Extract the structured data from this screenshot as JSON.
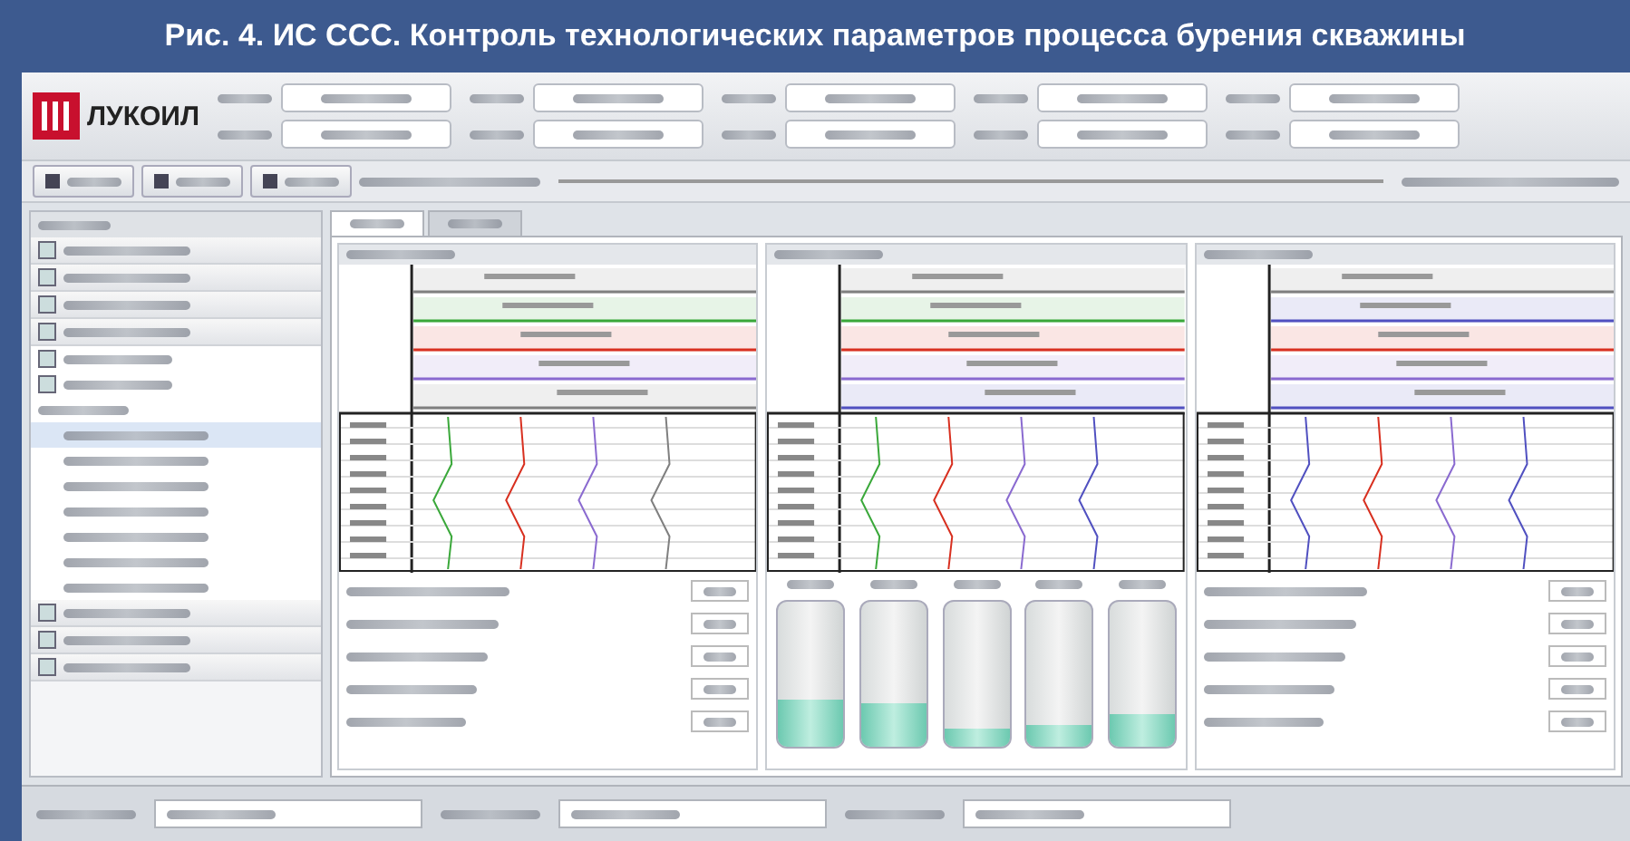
{
  "caption": "Рис. 4. ИС ССС. Контроль технологических параметров процесса бурения скважины",
  "header": {
    "brand": "ЛУКОИЛ",
    "rows": [
      [
        {
          "kind": "field"
        },
        {
          "kind": "field"
        },
        {
          "kind": "field"
        },
        {
          "kind": "field"
        },
        {
          "kind": "field"
        }
      ],
      [
        {
          "kind": "field"
        },
        {
          "kind": "field"
        },
        {
          "kind": "field"
        },
        {
          "kind": "field"
        },
        {
          "kind": "field"
        }
      ]
    ]
  },
  "toolbar": {
    "buttons": [
      {
        "kind": "button"
      },
      {
        "kind": "button"
      },
      {
        "kind": "button"
      }
    ]
  },
  "sidebar": {
    "items": [
      {
        "kind": "section"
      },
      {
        "kind": "section"
      },
      {
        "kind": "section"
      },
      {
        "kind": "section"
      },
      {
        "kind": "doc"
      },
      {
        "kind": "doc"
      },
      {
        "kind": "group"
      },
      {
        "kind": "row",
        "selected": true
      },
      {
        "kind": "row",
        "selected": false
      },
      {
        "kind": "row",
        "selected": false
      },
      {
        "kind": "row",
        "selected": false
      },
      {
        "kind": "row",
        "selected": false
      },
      {
        "kind": "row",
        "selected": false
      },
      {
        "kind": "row",
        "selected": false
      },
      {
        "kind": "section"
      },
      {
        "kind": "section"
      },
      {
        "kind": "section"
      }
    ]
  },
  "tabs": [
    {
      "selected": true
    },
    {
      "selected": false
    }
  ],
  "panels": [
    {
      "kind": "log",
      "tracks": [
        {
          "color": "#7f7f7f"
        },
        {
          "color": "#3aa83a"
        },
        {
          "color": "#d83020"
        },
        {
          "color": "#8a6ad0"
        },
        {
          "color": "#7f7f7f"
        }
      ]
    },
    {
      "kind": "log",
      "tracks": [
        {
          "color": "#7f7f7f"
        },
        {
          "color": "#3aa83a"
        },
        {
          "color": "#d83020"
        },
        {
          "color": "#8a6ad0"
        },
        {
          "color": "#5050c0"
        }
      ]
    },
    {
      "kind": "log",
      "tracks": [
        {
          "color": "#7f7f7f"
        },
        {
          "color": "#5050c0"
        },
        {
          "color": "#d83020"
        },
        {
          "color": "#8a6ad0"
        },
        {
          "color": "#5050c0"
        }
      ]
    }
  ],
  "tanks": [
    {
      "level": 0.32
    },
    {
      "level": 0.3
    },
    {
      "level": 0.12
    },
    {
      "level": 0.15
    },
    {
      "level": 0.22
    }
  ],
  "status": [
    {
      "kind": "field"
    },
    {
      "kind": "field"
    },
    {
      "kind": "field"
    }
  ]
}
